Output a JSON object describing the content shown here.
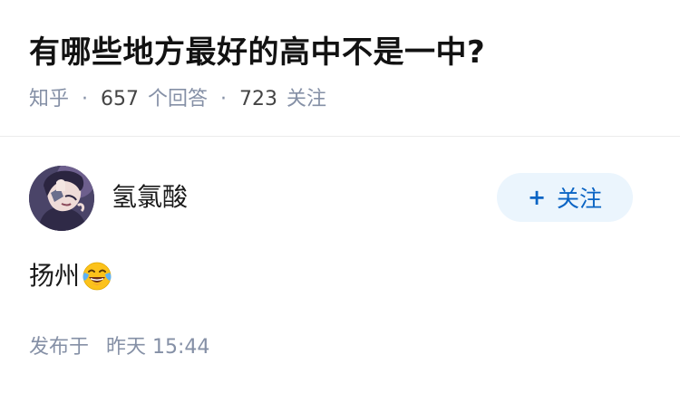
{
  "question": {
    "title": "有哪些地方最好的高中不是一中?",
    "source": "知乎",
    "answer_count": "657",
    "answer_count_label": "个回答",
    "follower_count": "723",
    "follower_count_label": "关注",
    "separator": "·"
  },
  "answer": {
    "author": {
      "name": "氢氯酸",
      "avatar_icon": "avatar-image"
    },
    "follow_button": {
      "plus": "+",
      "label": "关注"
    },
    "content": "扬州",
    "emoji": "face-with-tears-of-joy",
    "publish_label": "发布于",
    "publish_time": "昨天 15:44"
  },
  "colors": {
    "title": "#121212",
    "meta": "#8590a6",
    "follow_bg": "#ebf5fd",
    "follow_text": "#0a64c4"
  }
}
